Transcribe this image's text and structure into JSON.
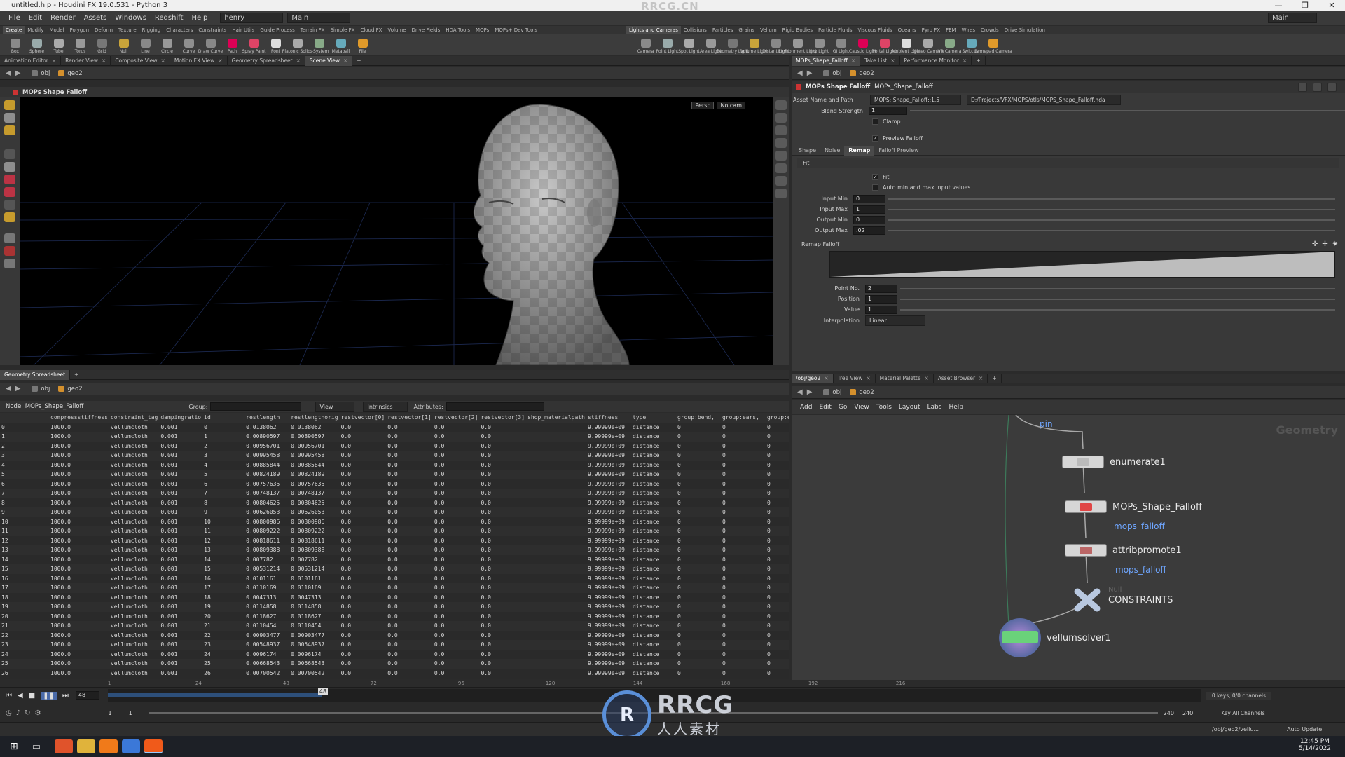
{
  "app": {
    "title": "untitled.hip - Houdini FX 19.0.531 - Python 3",
    "watermark": "RRCG.CN",
    "overlay_logo_text": "RRCG",
    "overlay_logo_sub": "人人素材"
  },
  "menu": [
    "File",
    "Edit",
    "Render",
    "Assets",
    "Windows",
    "Redshift",
    "Help"
  ],
  "desktop": {
    "name": "henry",
    "layout": "Main",
    "right_layout": "Main"
  },
  "shelf_tabs_left": [
    "Create",
    "Modify",
    "Model",
    "Polygon",
    "Deform",
    "Texture",
    "Rigging",
    "Characters",
    "Constraints",
    "Hair Utils",
    "Guide Process",
    "Terrain FX",
    "Simple FX",
    "Cloud FX",
    "Volume",
    "Drive Fields",
    "HDA Tools",
    "MOPs",
    "MOPs+ Dev Tools"
  ],
  "shelf_tools_left": [
    "Box",
    "Sphere",
    "Tube",
    "Torus",
    "Grid",
    "Null",
    "Line",
    "Circle",
    "Curve",
    "Draw Curve",
    "Path",
    "Spray Paint",
    "Font",
    "Platonic Solids",
    "L-System",
    "Metaball",
    "File"
  ],
  "shelf_tabs_right": [
    "Lights and Cameras",
    "Collisions",
    "Particles",
    "Grains",
    "Vellum",
    "Rigid Bodies",
    "Particle Fluids",
    "Viscous Fluids",
    "Oceans",
    "Pyro FX",
    "FEM",
    "Wires",
    "Crowds",
    "Drive Simulation"
  ],
  "shelf_tools_right": [
    "Camera",
    "Point Light",
    "Spot Light",
    "Area Light",
    "Geometry Light",
    "Volume Light",
    "Distant Light",
    "Environment Light",
    "Sky Light",
    "GI Light",
    "Caustic Light",
    "Portal Light",
    "Ambient Light",
    "Stereo Camera",
    "VR Camera",
    "Switcher",
    "Gamepad Camera"
  ],
  "pane_tabs_left": [
    "Animation Editor",
    "Render View",
    "Composite View",
    "Motion FX View",
    "Geometry Spreadsheet",
    "Scene View"
  ],
  "path": {
    "obj": "obj",
    "geo": "geo2"
  },
  "viewport": {
    "node_label": "MOPs Shape Falloff",
    "persp": "Persp",
    "cam": "No cam"
  },
  "params_tabs": [
    "MOPs_Shape_Falloff",
    "Take List",
    "Performance Monitor"
  ],
  "params": {
    "node_type": "MOPs Shape Falloff",
    "node_name": "MOPs_Shape_Falloff",
    "asset_label": "Asset Name and Path",
    "asset_name": "MOPS::Shape_Falloff::1.5",
    "asset_path": "D:/Projects/VFX/MOPS/otls/MOPS_Shape_Falloff.hda",
    "blend_label": "Blend Strength",
    "blend_value": "1",
    "clamp_label": "Clamp",
    "preview_label": "Preview Falloff",
    "subtabs": [
      "Shape",
      "Noise",
      "Remap",
      "Falloff Preview"
    ],
    "fit_header": "Fit",
    "fit_label": "Fit",
    "auto_label": "Auto min and max input values",
    "fields": [
      {
        "label": "Input Min",
        "value": "0"
      },
      {
        "label": "Input Max",
        "value": "1"
      },
      {
        "label": "Output Min",
        "value": "0"
      },
      {
        "label": "Output Max",
        "value": ".02"
      }
    ],
    "remap_label": "Remap Falloff",
    "ramp_fields": [
      {
        "label": "Point No.",
        "value": "2"
      },
      {
        "label": "Position",
        "value": "1"
      },
      {
        "label": "Value",
        "value": "1"
      }
    ],
    "interp_label": "Interpolation",
    "interp_value": "Linear"
  },
  "spreadsheet": {
    "tab": "Geometry Spreadsheet",
    "node_label": "Node: MOPs_Shape_Falloff",
    "group_label": "Group:",
    "view_label": "View",
    "intrinsics_label": "Intrinsics",
    "attributes_label": "Attributes:",
    "columns": [
      "",
      "compressstiffness",
      "constraint_tag",
      "dampingratio",
      "id",
      "restlength",
      "restlengthorig",
      "restvector[0]",
      "restvector[1]",
      "restvector[2]",
      "restvector[3]",
      "shop_materialpath",
      "stiffness",
      "type",
      "group:bend,",
      "group:ears,",
      "group:eyes,",
      "grou"
    ],
    "rows": [
      [
        "0",
        "1000.0",
        "vellumcloth",
        "0.001",
        "0",
        "0.0138062",
        "0.0138062",
        "0.0",
        "0.0",
        "0.0",
        "0.0",
        "",
        "9.99999e+09",
        "distance",
        "0",
        "0",
        "0",
        "0"
      ],
      [
        "1",
        "1000.0",
        "vellumcloth",
        "0.001",
        "1",
        "0.00890597",
        "0.00890597",
        "0.0",
        "0.0",
        "0.0",
        "0.0",
        "",
        "9.99999e+09",
        "distance",
        "0",
        "0",
        "0",
        "0"
      ],
      [
        "2",
        "1000.0",
        "vellumcloth",
        "0.001",
        "2",
        "0.00956701",
        "0.00956701",
        "0.0",
        "0.0",
        "0.0",
        "0.0",
        "",
        "9.99999e+09",
        "distance",
        "0",
        "0",
        "0",
        "0"
      ],
      [
        "3",
        "1000.0",
        "vellumcloth",
        "0.001",
        "3",
        "0.00995458",
        "0.00995458",
        "0.0",
        "0.0",
        "0.0",
        "0.0",
        "",
        "9.99999e+09",
        "distance",
        "0",
        "0",
        "0",
        "0"
      ],
      [
        "4",
        "1000.0",
        "vellumcloth",
        "0.001",
        "4",
        "0.00885844",
        "0.00885844",
        "0.0",
        "0.0",
        "0.0",
        "0.0",
        "",
        "9.99999e+09",
        "distance",
        "0",
        "0",
        "0",
        "0"
      ],
      [
        "5",
        "1000.0",
        "vellumcloth",
        "0.001",
        "5",
        "0.00824189",
        "0.00824189",
        "0.0",
        "0.0",
        "0.0",
        "0.0",
        "",
        "9.99999e+09",
        "distance",
        "0",
        "0",
        "0",
        "0"
      ],
      [
        "6",
        "1000.0",
        "vellumcloth",
        "0.001",
        "6",
        "0.00757635",
        "0.00757635",
        "0.0",
        "0.0",
        "0.0",
        "0.0",
        "",
        "9.99999e+09",
        "distance",
        "0",
        "0",
        "0",
        "0"
      ],
      [
        "7",
        "1000.0",
        "vellumcloth",
        "0.001",
        "7",
        "0.00748137",
        "0.00748137",
        "0.0",
        "0.0",
        "0.0",
        "0.0",
        "",
        "9.99999e+09",
        "distance",
        "0",
        "0",
        "0",
        "0"
      ],
      [
        "8",
        "1000.0",
        "vellumcloth",
        "0.001",
        "8",
        "0.00804625",
        "0.00804625",
        "0.0",
        "0.0",
        "0.0",
        "0.0",
        "",
        "9.99999e+09",
        "distance",
        "0",
        "0",
        "0",
        "0"
      ],
      [
        "9",
        "1000.0",
        "vellumcloth",
        "0.001",
        "9",
        "0.00626053",
        "0.00626053",
        "0.0",
        "0.0",
        "0.0",
        "0.0",
        "",
        "9.99999e+09",
        "distance",
        "0",
        "0",
        "0",
        "0"
      ],
      [
        "10",
        "1000.0",
        "vellumcloth",
        "0.001",
        "10",
        "0.00800986",
        "0.00800986",
        "0.0",
        "0.0",
        "0.0",
        "0.0",
        "",
        "9.99999e+09",
        "distance",
        "0",
        "0",
        "0",
        "0"
      ],
      [
        "11",
        "1000.0",
        "vellumcloth",
        "0.001",
        "11",
        "0.00809222",
        "0.00809222",
        "0.0",
        "0.0",
        "0.0",
        "0.0",
        "",
        "9.99999e+09",
        "distance",
        "0",
        "0",
        "0",
        "0"
      ],
      [
        "12",
        "1000.0",
        "vellumcloth",
        "0.001",
        "12",
        "0.00818611",
        "0.00818611",
        "0.0",
        "0.0",
        "0.0",
        "0.0",
        "",
        "9.99999e+09",
        "distance",
        "0",
        "0",
        "0",
        "0"
      ],
      [
        "13",
        "1000.0",
        "vellumcloth",
        "0.001",
        "13",
        "0.00809388",
        "0.00809388",
        "0.0",
        "0.0",
        "0.0",
        "0.0",
        "",
        "9.99999e+09",
        "distance",
        "0",
        "0",
        "0",
        "0"
      ],
      [
        "14",
        "1000.0",
        "vellumcloth",
        "0.001",
        "14",
        "0.007782",
        "0.007782",
        "0.0",
        "0.0",
        "0.0",
        "0.0",
        "",
        "9.99999e+09",
        "distance",
        "0",
        "0",
        "0",
        "0"
      ],
      [
        "15",
        "1000.0",
        "vellumcloth",
        "0.001",
        "15",
        "0.00531214",
        "0.00531214",
        "0.0",
        "0.0",
        "0.0",
        "0.0",
        "",
        "9.99999e+09",
        "distance",
        "0",
        "0",
        "0",
        "0"
      ],
      [
        "16",
        "1000.0",
        "vellumcloth",
        "0.001",
        "16",
        "0.0101161",
        "0.0101161",
        "0.0",
        "0.0",
        "0.0",
        "0.0",
        "",
        "9.99999e+09",
        "distance",
        "0",
        "0",
        "0",
        "0"
      ],
      [
        "17",
        "1000.0",
        "vellumcloth",
        "0.001",
        "17",
        "0.0110169",
        "0.0110169",
        "0.0",
        "0.0",
        "0.0",
        "0.0",
        "",
        "9.99999e+09",
        "distance",
        "0",
        "0",
        "0",
        "0"
      ],
      [
        "18",
        "1000.0",
        "vellumcloth",
        "0.001",
        "18",
        "0.0047313",
        "0.0047313",
        "0.0",
        "0.0",
        "0.0",
        "0.0",
        "",
        "9.99999e+09",
        "distance",
        "0",
        "0",
        "0",
        "0"
      ],
      [
        "19",
        "1000.0",
        "vellumcloth",
        "0.001",
        "19",
        "0.0114858",
        "0.0114858",
        "0.0",
        "0.0",
        "0.0",
        "0.0",
        "",
        "9.99999e+09",
        "distance",
        "0",
        "0",
        "0",
        "0"
      ],
      [
        "20",
        "1000.0",
        "vellumcloth",
        "0.001",
        "20",
        "0.0118627",
        "0.0118627",
        "0.0",
        "0.0",
        "0.0",
        "0.0",
        "",
        "9.99999e+09",
        "distance",
        "0",
        "0",
        "0",
        "0"
      ],
      [
        "21",
        "1000.0",
        "vellumcloth",
        "0.001",
        "21",
        "0.0110454",
        "0.0110454",
        "0.0",
        "0.0",
        "0.0",
        "0.0",
        "",
        "9.99999e+09",
        "distance",
        "0",
        "0",
        "0",
        "0"
      ],
      [
        "22",
        "1000.0",
        "vellumcloth",
        "0.001",
        "22",
        "0.00903477",
        "0.00903477",
        "0.0",
        "0.0",
        "0.0",
        "0.0",
        "",
        "9.99999e+09",
        "distance",
        "0",
        "0",
        "0",
        "0"
      ],
      [
        "23",
        "1000.0",
        "vellumcloth",
        "0.001",
        "23",
        "0.00548937",
        "0.00548937",
        "0.0",
        "0.0",
        "0.0",
        "0.0",
        "",
        "9.99999e+09",
        "distance",
        "0",
        "0",
        "0",
        "0"
      ],
      [
        "24",
        "1000.0",
        "vellumcloth",
        "0.001",
        "24",
        "0.0096174",
        "0.0096174",
        "0.0",
        "0.0",
        "0.0",
        "0.0",
        "",
        "9.99999e+09",
        "distance",
        "0",
        "0",
        "0",
        "0"
      ],
      [
        "25",
        "1000.0",
        "vellumcloth",
        "0.001",
        "25",
        "0.00668543",
        "0.00668543",
        "0.0",
        "0.0",
        "0.0",
        "0.0",
        "",
        "9.99999e+09",
        "distance",
        "0",
        "0",
        "0",
        "0"
      ],
      [
        "26",
        "1000.0",
        "vellumcloth",
        "0.001",
        "26",
        "0.00700542",
        "0.00700542",
        "0.0",
        "0.0",
        "0.0",
        "0.0",
        "",
        "9.99999e+09",
        "distance",
        "0",
        "0",
        "0",
        "0"
      ]
    ]
  },
  "network": {
    "tabs": [
      "/obj/geo2",
      "Tree View",
      "Material Palette",
      "Asset Browser"
    ],
    "menu": [
      "Add",
      "Edit",
      "Go",
      "View",
      "Tools",
      "Layout",
      "Labs",
      "Help"
    ],
    "context_label": "Geometry",
    "pin_label": "pin",
    "nodes": [
      {
        "name": "enumerate1",
        "sub": ""
      },
      {
        "name": "MOPs_Shape_Falloff",
        "sub": "mops_falloff"
      },
      {
        "name": "attribpromote1",
        "sub": "mops_falloff"
      },
      {
        "name": "CONSTRAINTS",
        "sub": "Null"
      },
      {
        "name": "vellumsolver1",
        "sub": ""
      }
    ]
  },
  "timeline": {
    "frame": "48",
    "start": "1",
    "start2": "1",
    "end": "240",
    "end2": "240",
    "ticks": [
      "1",
      "24",
      "48",
      "72",
      "96",
      "120",
      "144",
      "168",
      "192",
      "216"
    ],
    "keys_label": "0 keys, 0/0 channels",
    "key_all": "Key All Channels",
    "path": "/obj/geo2/vellu...",
    "auto_update": "Auto Update"
  },
  "taskbar": {
    "time": "12:45 PM",
    "date": "5/14/2022"
  }
}
